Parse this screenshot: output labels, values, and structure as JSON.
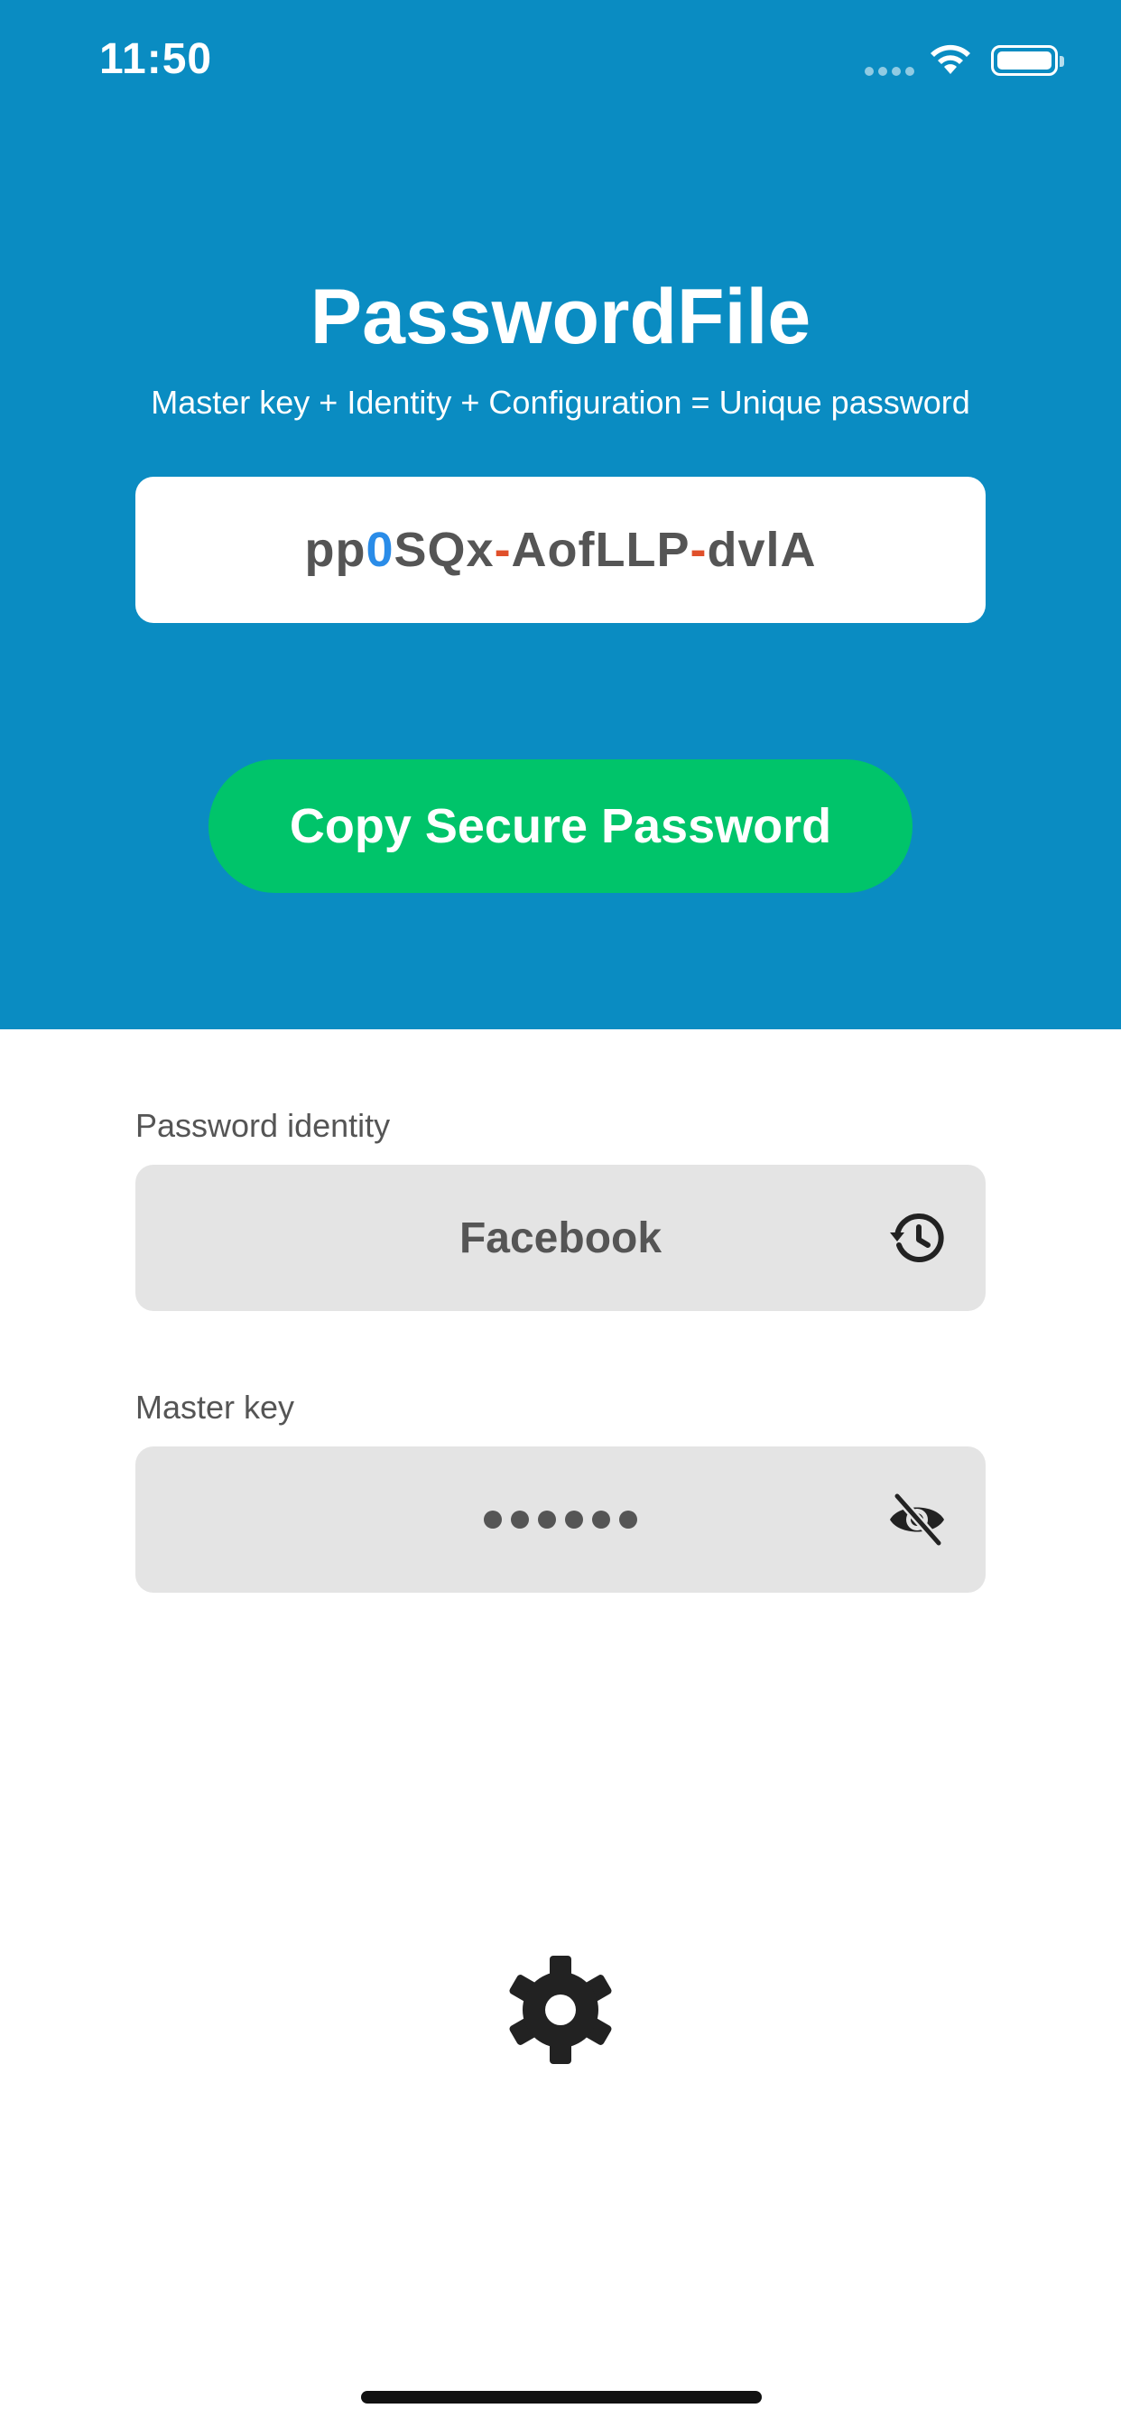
{
  "status_bar": {
    "time": "11:50"
  },
  "header": {
    "title": "PasswordFile",
    "subtitle": "Master key + Identity + Configuration = Unique password"
  },
  "password": {
    "segments": [
      "pp",
      "0",
      "SQx",
      "-",
      "AofLLP",
      "-",
      "dvlA"
    ],
    "colors": {
      "digit": "#2a8ce8",
      "separator": "#e0502b",
      "text": "#555555"
    }
  },
  "copy_button": {
    "label": "Copy Secure Password",
    "color": "#00c46a"
  },
  "identity": {
    "label": "Password identity",
    "value": "Facebook",
    "icon": "history-icon"
  },
  "master_key": {
    "label": "Master key",
    "masked_value": "••••••",
    "icon": "eye-off-icon"
  },
  "settings": {
    "icon": "gear-icon"
  },
  "theme": {
    "header_bg": "#0a8cc2",
    "field_bg": "#e4e4e4"
  }
}
